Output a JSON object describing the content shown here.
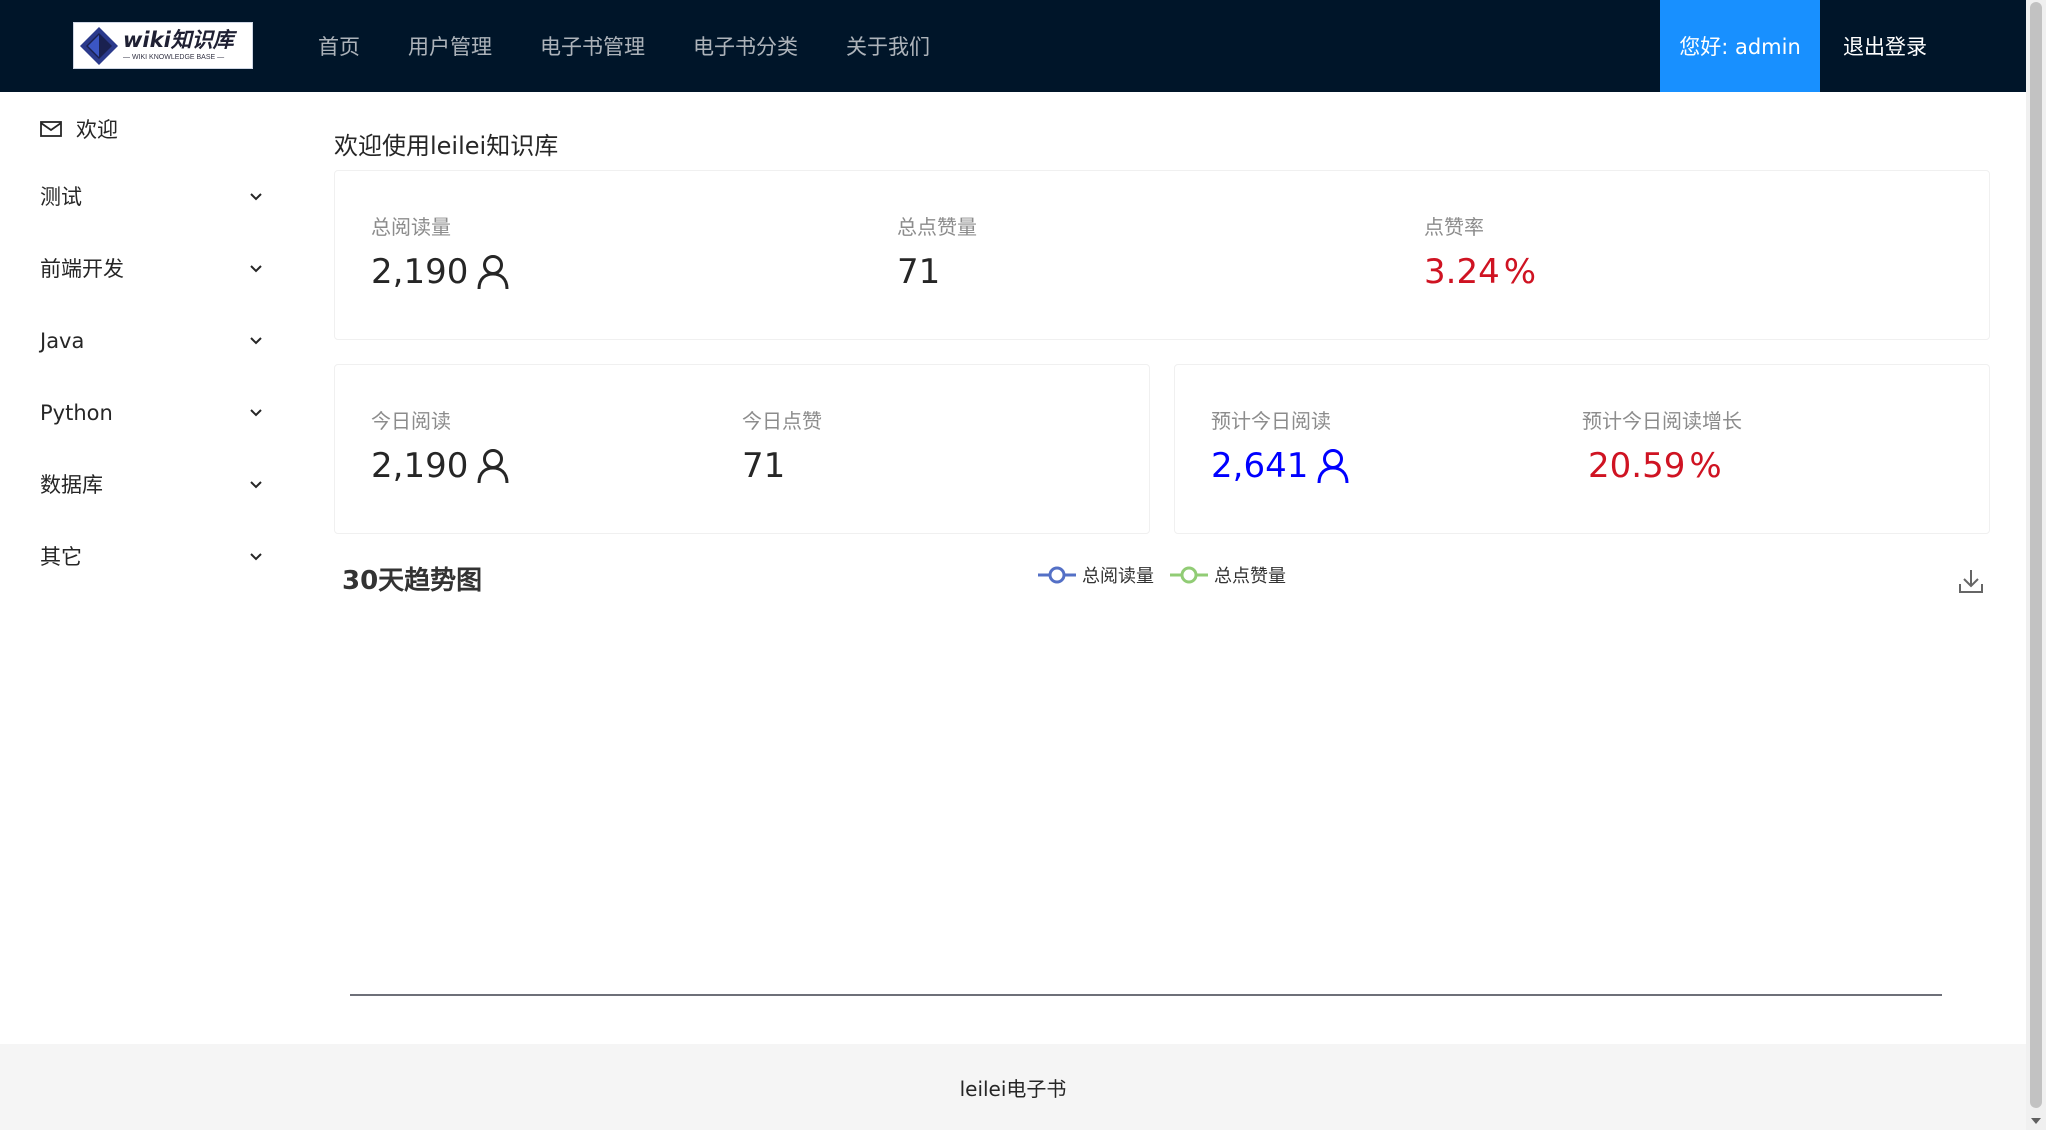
{
  "header": {
    "logo_main": "wiki知识库",
    "logo_sub": "— WIKI KNOWLEDGE BASE —",
    "nav": [
      "首页",
      "用户管理",
      "电子书管理",
      "电子书分类",
      "关于我们"
    ],
    "greeting": "您好: admin",
    "logout": "退出登录",
    "accent_color": "#1890ff",
    "bg_color": "#001529"
  },
  "sidebar": {
    "welcome": "欢迎",
    "submenus": [
      "测试",
      "前端开发",
      "Java",
      "Python",
      "数据库",
      "其它"
    ]
  },
  "main": {
    "title": "欢迎使用leilei知识库",
    "overview": {
      "total_views_label": "总阅读量",
      "total_views": "2,190",
      "total_likes_label": "总点赞量",
      "total_likes": "71",
      "like_rate_label": "点赞率",
      "like_rate": "3.24",
      "like_rate_suffix": "%"
    },
    "today": {
      "views_label": "今日阅读",
      "views": "2,190",
      "likes_label": "今日点赞",
      "likes": "71"
    },
    "forecast": {
      "views_label": "预计今日阅读",
      "views": "2,641",
      "growth_label": "预计今日阅读增长",
      "growth": "20.59",
      "growth_suffix": "%"
    }
  },
  "chart_data": {
    "type": "line",
    "title": "30天趋势图",
    "series": [
      {
        "name": "总阅读量",
        "color": "#5470c6",
        "values": []
      },
      {
        "name": "总点赞量",
        "color": "#91cc75",
        "values": []
      }
    ],
    "x": [],
    "xlabel": "",
    "ylabel": "",
    "grid": false,
    "legend": "top-center"
  },
  "footer": {
    "text": "leilei电子书"
  },
  "colors": {
    "positive_red": "#cf1322",
    "forecast_blue": "#0000ff"
  }
}
